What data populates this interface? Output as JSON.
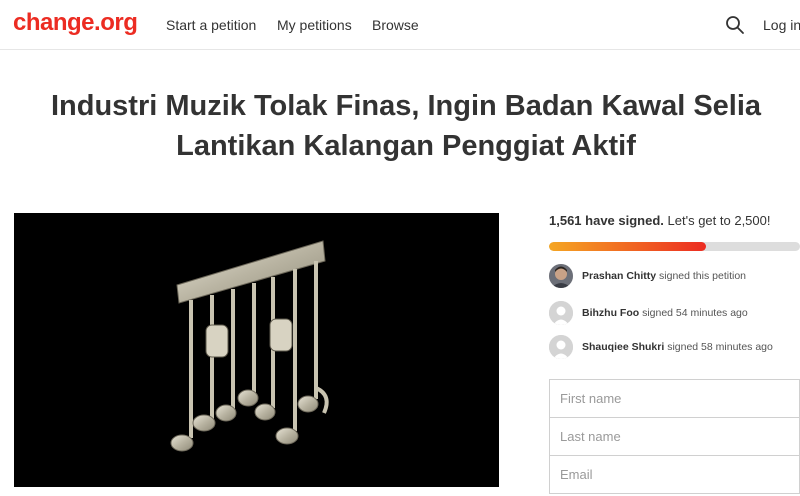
{
  "header": {
    "logo": "change.org",
    "nav": [
      "Start a petition",
      "My petitions",
      "Browse"
    ],
    "login": "Log in",
    "search_icon": "search-icon"
  },
  "petition": {
    "title_line1": "Industri Muzik Tolak Finas, Ingin Badan Kawal Selia",
    "title_line2": "Lantikan Kalangan Penggiat Aktif",
    "image_icon": "music-notes-prison-bars-illustration"
  },
  "progress": {
    "signed_count": "1,561 have signed.",
    "goal_text": "Let's get to 2,500!",
    "fraction": 0.6244
  },
  "recent_signers": [
    {
      "name": "Prashan Chitty",
      "action": "signed this petition",
      "avatar": "user-photo"
    },
    {
      "name": "Bihzhu Foo",
      "action": "signed 54 minutes ago",
      "avatar": "default-avatar-icon"
    },
    {
      "name": "Shauqiee Shukri",
      "action": "signed 58 minutes ago",
      "avatar": "default-avatar-icon"
    }
  ],
  "form": {
    "first_name_placeholder": "First name",
    "last_name_placeholder": "Last name",
    "email_placeholder": "Email"
  },
  "colors": {
    "brand": "#ec2c22",
    "progress_start": "#f5a623",
    "progress_end": "#ec2c22",
    "track": "#dddddd"
  }
}
